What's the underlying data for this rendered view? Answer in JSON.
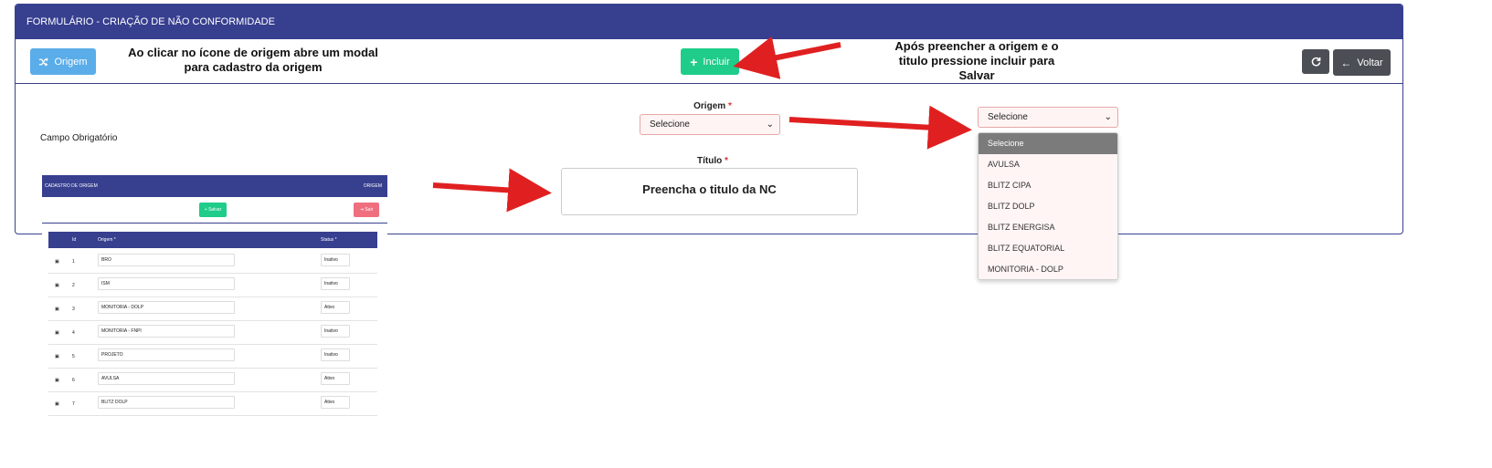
{
  "header": {
    "title": "FORMULÁRIO - CRIAÇÃO DE NÃO CONFORMIDADE"
  },
  "toolbar": {
    "origem_label": "Origem",
    "incluir_label": "Incluir",
    "voltar_label": "Voltar"
  },
  "annotations": {
    "left": "Ao clicar no ícone de origem abre um modal para cadastro da origem",
    "right": "Após preencher a origem e o titulo pressione incluir para Salvar"
  },
  "form": {
    "required_note": "Campo Obrigatório",
    "origem_label": "Origem",
    "titulo_label": "Título",
    "required_mark": "*",
    "origem_value": "Selecione",
    "titulo_value": "Preencha o titulo da NC"
  },
  "dropdown": {
    "selected": "Selecione",
    "options": [
      "Selecione",
      "AVULSA",
      "BLITZ CIPA",
      "BLITZ DOLP",
      "BLITZ ENERGISA",
      "BLITZ EQUATORIAL",
      "MONITORIA - DOLP"
    ]
  },
  "modal_preview": {
    "title": "CADASTRO DE ORIGEM",
    "right_title": "ORIGEM",
    "salvar_label": "Salvar",
    "sair_label": "Sair",
    "columns": [
      "Id",
      "Origem *",
      "Status *"
    ],
    "rows": [
      {
        "id": "1",
        "origem": "BRO",
        "status": "Inativo"
      },
      {
        "id": "2",
        "origem": "ISM",
        "status": "Inativo"
      },
      {
        "id": "3",
        "origem": "MONITORIA - DOLP",
        "status": "Ativo"
      },
      {
        "id": "4",
        "origem": "MONITORIA - FNPI",
        "status": "Inativo"
      },
      {
        "id": "5",
        "origem": "PROJETO",
        "status": "Inativo"
      },
      {
        "id": "6",
        "origem": "AVULSA",
        "status": "Ativo"
      },
      {
        "id": "7",
        "origem": "BLITZ DOLP",
        "status": "Ativo"
      }
    ]
  },
  "colors": {
    "header": "#373f8f",
    "origem_button": "#5aade9",
    "incluir_button": "#1fcc8a",
    "dark_button": "#4b4f55",
    "arrow": "#e02020",
    "select_bg": "#fff4f4"
  }
}
